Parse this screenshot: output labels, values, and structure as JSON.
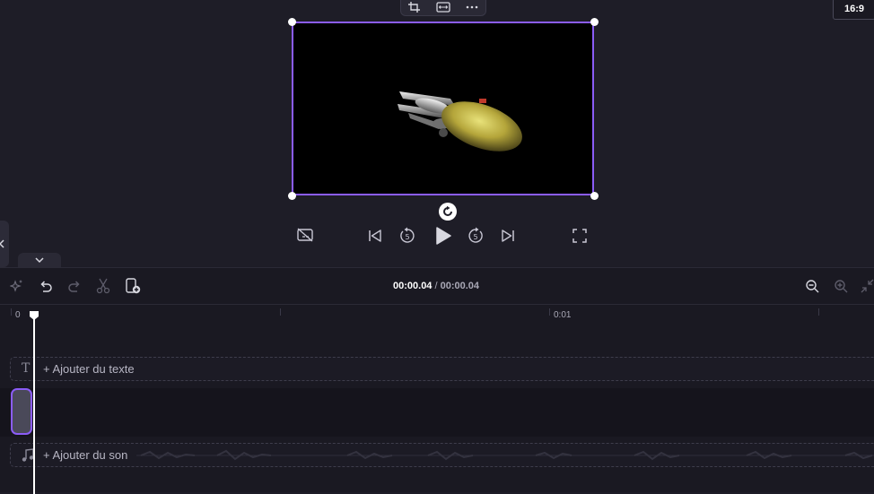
{
  "preview": {
    "aspect_ratio": "16:9",
    "toolbar_icons": [
      "crop-icon",
      "fit-icon",
      "more-icon"
    ]
  },
  "player": {
    "icons": [
      "captions-off-icon",
      "skip-back-icon",
      "rewind-5-icon",
      "play-icon",
      "forward-5-icon",
      "skip-forward-icon",
      "fullscreen-icon"
    ]
  },
  "timeline": {
    "current_time": "00:00.04",
    "separator": " / ",
    "total_time": "00:00.04",
    "ruler": {
      "start_label": "0",
      "mark_label": "0:01"
    },
    "text_track_label": "+ Ajouter du texte",
    "audio_track_label": "+ Ajouter du son"
  },
  "colors": {
    "accent": "#8b5cf6",
    "background": "#1e1d27",
    "timeline_bg": "#1a1922"
  }
}
